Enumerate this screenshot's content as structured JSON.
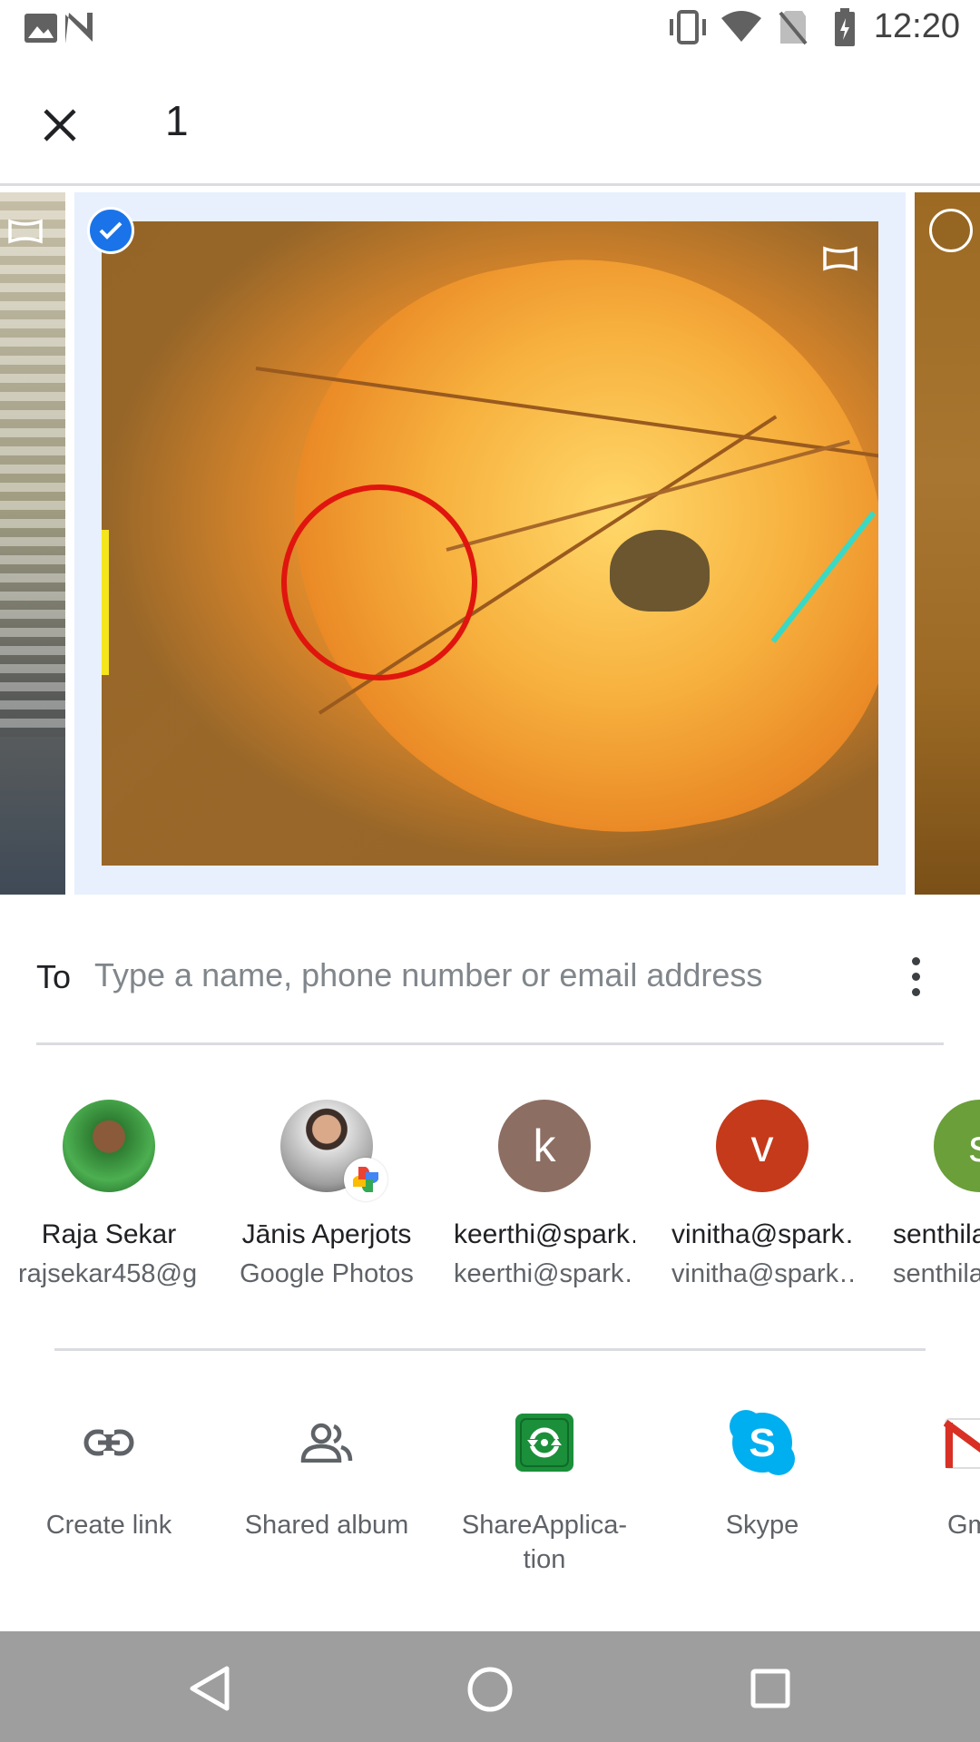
{
  "status_bar": {
    "time": "12:20",
    "left_icons": [
      "image-icon",
      "n-logo-icon"
    ],
    "right_icons": [
      "vibrate-icon",
      "wifi-icon",
      "no-sim-icon",
      "battery-icon"
    ]
  },
  "header": {
    "close_icon": "close-icon",
    "selected_count": "1"
  },
  "image_strip": {
    "selected_check": true,
    "badges": [
      "panorama-icon"
    ]
  },
  "to_field": {
    "label": "To",
    "placeholder": "Type a name, phone number or email address",
    "value": ""
  },
  "contacts": [
    {
      "name": "Raja Sekar",
      "sub": "rajsekar458@g…",
      "avatar": "photo"
    },
    {
      "name": "Jānis Aperjots",
      "sub": "Google Photos",
      "avatar": "photo"
    },
    {
      "name": "keerthi@spark…",
      "sub": "keerthi@spark…",
      "avatar_letter": "k",
      "color": "#8d6e63"
    },
    {
      "name": "vinitha@spark…",
      "sub": "vinitha@spark…",
      "avatar_letter": "v",
      "color": "#c53a1b"
    },
    {
      "name": "senthila",
      "sub": "senthila",
      "avatar_letter": "s",
      "color": "#6a9f3a"
    }
  ],
  "apps": [
    {
      "label": "Create link",
      "icon": "link-icon"
    },
    {
      "label": "Shared album",
      "icon": "people-icon"
    },
    {
      "label": "ShareApplica-\ntion",
      "icon": "shareapp-icon"
    },
    {
      "label": "Skype",
      "icon": "skype-icon"
    },
    {
      "label": "Gm",
      "icon": "gmail-icon"
    }
  ],
  "nav_bar": {
    "icons": [
      "back-icon",
      "home-icon",
      "recents-icon"
    ]
  },
  "colors": {
    "accent": "#1a73e8",
    "selection_bg": "#e8f0fe",
    "nav_bar": "#9e9e9e"
  }
}
